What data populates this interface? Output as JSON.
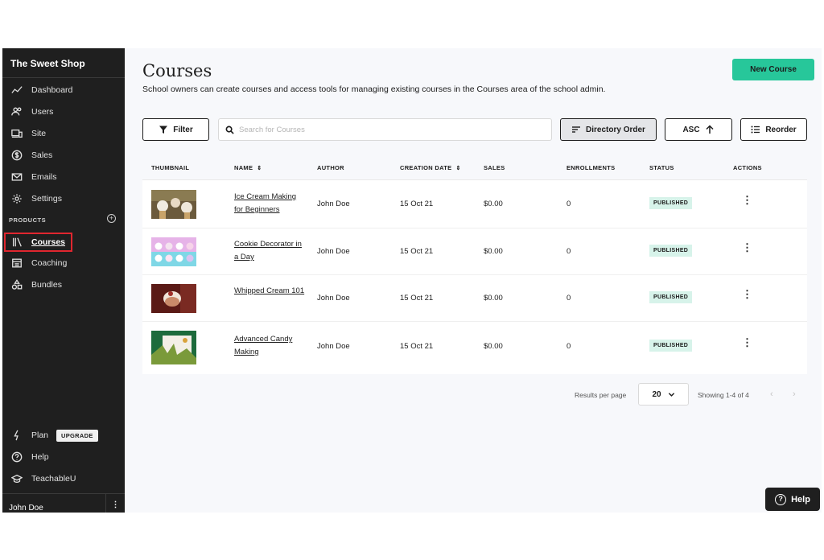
{
  "sidebar": {
    "brand": "The Sweet Shop",
    "items": [
      {
        "label": "Dashboard",
        "icon": "chart-line-icon"
      },
      {
        "label": "Users",
        "icon": "users-icon"
      },
      {
        "label": "Site",
        "icon": "devices-icon"
      },
      {
        "label": "Sales",
        "icon": "dollar-icon"
      },
      {
        "label": "Emails",
        "icon": "envelope-icon"
      },
      {
        "label": "Settings",
        "icon": "gear-icon"
      }
    ],
    "section_label": "PRODUCTS",
    "products": [
      {
        "label": "Courses",
        "icon": "library-icon",
        "active": true
      },
      {
        "label": "Coaching",
        "icon": "calendar-icon"
      },
      {
        "label": "Bundles",
        "icon": "shapes-icon"
      }
    ],
    "bottom": [
      {
        "label": "Plan",
        "icon": "bolt-icon"
      },
      {
        "label": "Help",
        "icon": "question-icon"
      },
      {
        "label": "TeachableU",
        "icon": "graduation-cap-icon"
      }
    ],
    "upgrade_label": "UPGRADE",
    "user_name": "John Doe",
    "user_menu": "⋮"
  },
  "header": {
    "title": "Courses",
    "subtitle": "School owners can create courses and access tools for managing existing courses in the Courses area of the school admin.",
    "new_course_label": "New Course"
  },
  "toolbar": {
    "filter_label": "Filter",
    "search_placeholder": "Search for Courses",
    "directory_order_label": "Directory Order",
    "asc_label": "ASC",
    "reorder_label": "Reorder"
  },
  "table": {
    "columns": [
      "THUMBNAIL",
      "NAME",
      "AUTHOR",
      "CREATION DATE",
      "SALES",
      "ENROLLMENTS",
      "STATUS",
      "ACTIONS"
    ],
    "rows": [
      {
        "name": "Ice Cream Making for Beginners",
        "author": "John Doe",
        "date": "15 Oct 21",
        "sales": "$0.00",
        "enrollments": "0",
        "status": "PUBLISHED"
      },
      {
        "name": "Cookie Decorator in a Day",
        "author": "John Doe",
        "date": "15 Oct 21",
        "sales": "$0.00",
        "enrollments": "0",
        "status": "PUBLISHED"
      },
      {
        "name": "Whipped Cream 101",
        "author": "John Doe",
        "date": "15 Oct 21",
        "sales": "$0.00",
        "enrollments": "0",
        "status": "PUBLISHED"
      },
      {
        "name": "Advanced Candy Making",
        "author": "John Doe",
        "date": "15 Oct 21",
        "sales": "$0.00",
        "enrollments": "0",
        "status": "PUBLISHED"
      }
    ]
  },
  "pagination": {
    "results_per_page_label": "Results per page",
    "results_per_page": "20",
    "showing": "Showing 1-4 of 4",
    "prev": "‹",
    "next": "›"
  },
  "help_button": "Help",
  "colors": {
    "accent": "#27c79a",
    "sidebar_bg": "#1f1f1f",
    "highlight": "#e0262f",
    "badge_bg": "#d7f3ea"
  }
}
